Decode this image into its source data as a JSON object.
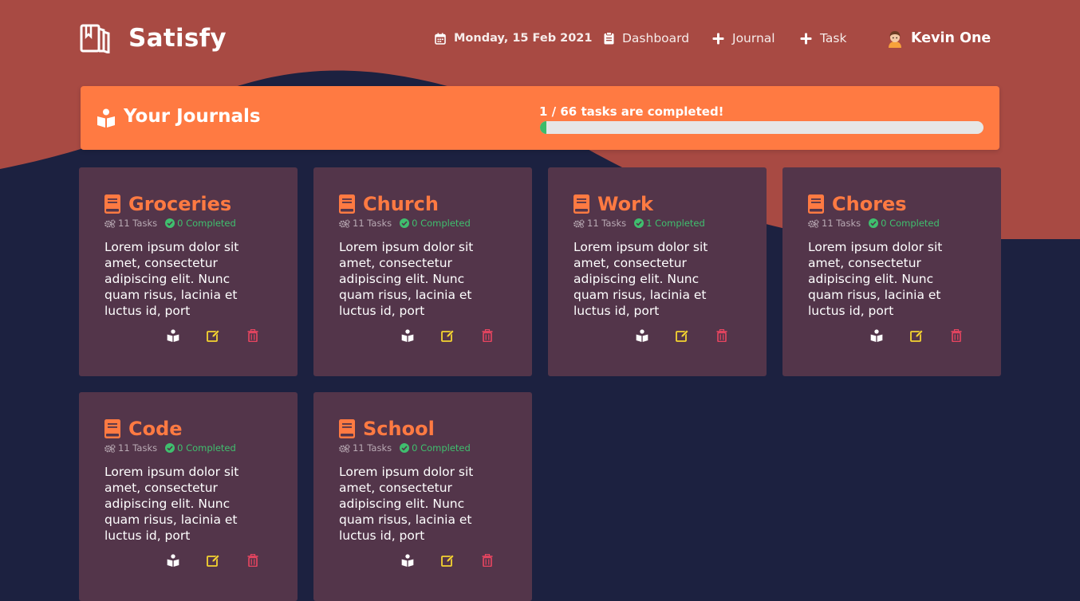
{
  "brand": {
    "name": "Satisfy",
    "logo_icon": "book-open-icon"
  },
  "nav": {
    "date": "Monday, 15 Feb 2021",
    "dashboard": "Dashboard",
    "journal": "Journal",
    "task": "Task",
    "user": "Kevin One"
  },
  "banner": {
    "title": "Your Journals",
    "progress_text": "1 / 66 tasks are completed!",
    "completed": 1,
    "total": 66
  },
  "colors": {
    "accent": "#ff7a42",
    "header_bg": "#a84a43",
    "page_bg": "#1c2140",
    "card_bg": "#53354a",
    "success": "#3fbf6e",
    "edit": "#f5d430",
    "delete": "#e94560"
  },
  "journals": [
    {
      "title": "Groceries",
      "tasks": "11 Tasks",
      "completed": "0 Completed",
      "description": "Lorem ipsum dolor sit amet, consectetur adipiscing elit. Nunc quam risus, lacinia et luctus id, port"
    },
    {
      "title": "Church",
      "tasks": "11 Tasks",
      "completed": "0 Completed",
      "description": "Lorem ipsum dolor sit amet, consectetur adipiscing elit. Nunc quam risus, lacinia et luctus id, port"
    },
    {
      "title": "Work",
      "tasks": "11 Tasks",
      "completed": "1 Completed",
      "description": "Lorem ipsum dolor sit amet, consectetur adipiscing elit. Nunc quam risus, lacinia et luctus id, port"
    },
    {
      "title": "Chores",
      "tasks": "11 Tasks",
      "completed": "0 Completed",
      "description": "Lorem ipsum dolor sit amet, consectetur adipiscing elit. Nunc quam risus, lacinia et luctus id, port"
    },
    {
      "title": "Code",
      "tasks": "11 Tasks",
      "completed": "0 Completed",
      "description": "Lorem ipsum dolor sit amet, consectetur adipiscing elit. Nunc quam risus, lacinia et luctus id, port"
    },
    {
      "title": "School",
      "tasks": "11 Tasks",
      "completed": "0 Completed",
      "description": "Lorem ipsum dolor sit amet, consectetur adipiscing elit. Nunc quam risus, lacinia et luctus id, port"
    }
  ]
}
